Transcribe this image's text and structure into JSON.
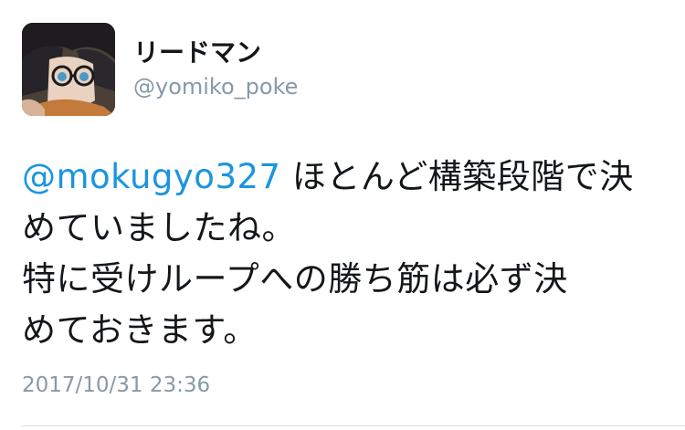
{
  "user": {
    "display_name": "リードマン",
    "handle": "@yomiko_poke"
  },
  "tweet": {
    "mention": "@mokugyo327",
    "line1_rest": " ほとんど構築段階で決",
    "line2": "めていましたね。",
    "line3": "特に受けループへの勝ち筋は必ず決",
    "line4": "めておきます。",
    "timestamp": "2017/10/31 23:36"
  },
  "colors": {
    "mention": "#1b95e0",
    "secondary_text": "#8899a6",
    "primary_text": "#14171a"
  }
}
